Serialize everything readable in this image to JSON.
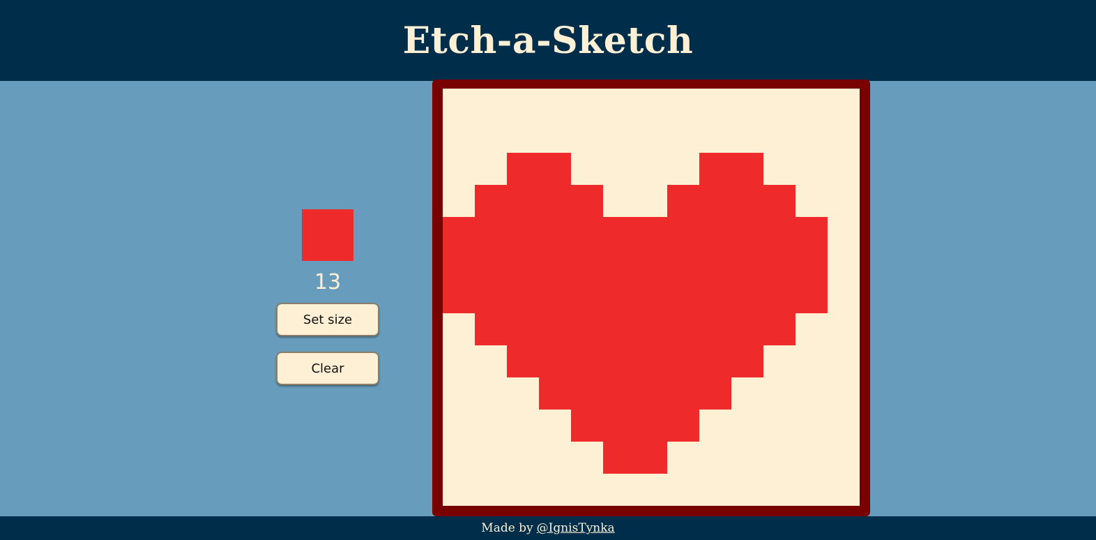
{
  "header": {
    "title": "Etch-a-Sketch"
  },
  "controls": {
    "current_color": "#ee2a2a",
    "grid_size_display": "13",
    "set_size_label": "Set size",
    "clear_label": "Clear"
  },
  "board": {
    "grid_size": 13,
    "background_color": "#fdf0d5",
    "frame_color": "#780000",
    "fill_color": "#ee2a2a",
    "painted_rows": [
      "0000000000000",
      "0000000000000",
      "0011000011000",
      "0111100111100",
      "1111111111110",
      "1111111111110",
      "1111111111110",
      "0111111111100",
      "0011111111000",
      "0001111110000",
      "0000111100000",
      "0000011000000",
      "0000000000000"
    ]
  },
  "footer": {
    "made_by_text": "Made by",
    "author_link": "@IgnisTynka"
  },
  "colors": {
    "header_bg": "#002e4a",
    "page_bg": "#679cbc",
    "cream": "#fdf0d5"
  }
}
